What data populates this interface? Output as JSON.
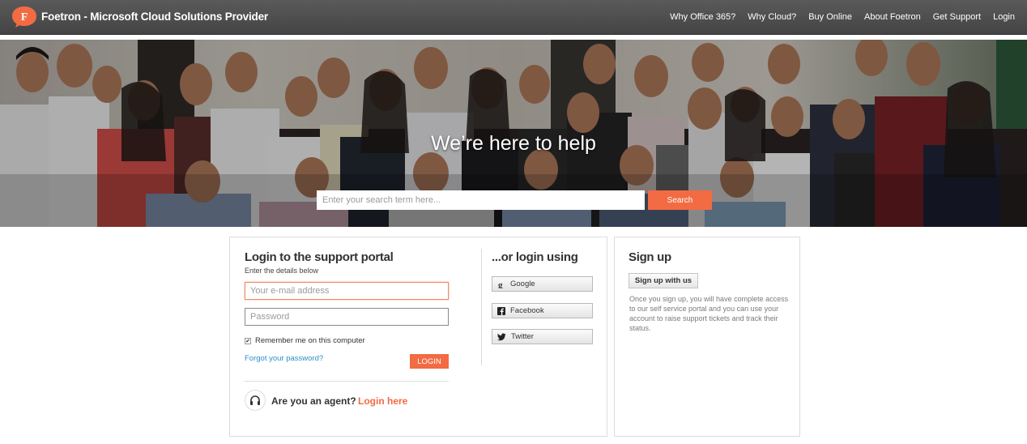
{
  "header": {
    "logo_letter": "F",
    "brand_title": "Foetron - Microsoft Cloud Solutions Provider",
    "nav": [
      {
        "label": "Why Office 365?"
      },
      {
        "label": "Why Cloud?"
      },
      {
        "label": "Buy Online"
      },
      {
        "label": "About Foetron"
      },
      {
        "label": "Get Support"
      },
      {
        "label": "Login"
      }
    ]
  },
  "hero": {
    "title": "We’re here to help",
    "search_placeholder": "Enter your search term here...",
    "search_button": "Search"
  },
  "login": {
    "title": "Login to the support portal",
    "subtitle": "Enter the details below",
    "email_placeholder": "Your e-mail address",
    "password_placeholder": "Password",
    "remember_label": "Remember me on this computer",
    "remember_checked": true,
    "forgot_link": "Forgot your password?",
    "login_button": "LOGIN",
    "agent_question": "Are you an agent?",
    "agent_link": "Login here"
  },
  "social_login": {
    "title": "...or login using",
    "providers": [
      {
        "label": "Google",
        "icon": "google-icon"
      },
      {
        "label": "Facebook",
        "icon": "facebook-icon"
      },
      {
        "label": "Twitter",
        "icon": "twitter-icon"
      }
    ]
  },
  "signup": {
    "title": "Sign up",
    "button": "Sign up with us",
    "description": "Once you sign up, you will have complete access to our self service portal and you can use your account to raise support tickets and track their status."
  },
  "colors": {
    "accent": "#f26b43",
    "header_bg": "#4d4d4d",
    "link": "#2a8fc9"
  }
}
